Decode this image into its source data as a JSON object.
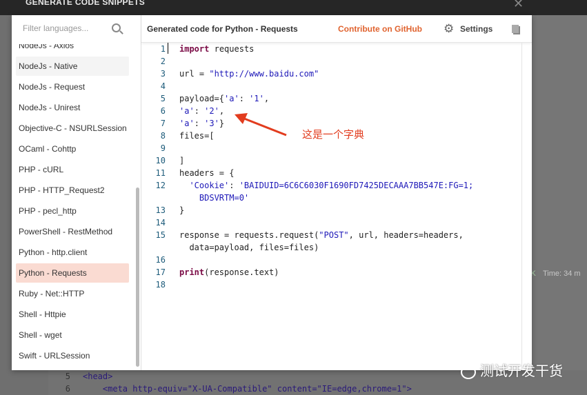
{
  "modal": {
    "title": "GENERATE CODE SNIPPETS"
  },
  "sidebar": {
    "filter_placeholder": "Filter languages...",
    "items": [
      "NodeJs - Axios",
      "NodeJs - Native",
      "NodeJs - Request",
      "NodeJs - Unirest",
      "Objective-C - NSURLSession",
      "OCaml - Cohttp",
      "PHP - cURL",
      "PHP - HTTP_Request2",
      "PHP - pecl_http",
      "PowerShell - RestMethod",
      "Python - http.client",
      "Python - Requests",
      "Ruby - Net::HTTP",
      "Shell - Httpie",
      "Shell - wget",
      "Swift - URLSession"
    ],
    "selected": "Python - Requests"
  },
  "header": {
    "title": "Generated code for Python - Requests",
    "github": "Contribute on GitHub",
    "settings": "Settings"
  },
  "code": [
    {
      "n": "1",
      "t": [
        [
          "kw",
          "import"
        ],
        [
          "",
          "requests"
        ]
      ]
    },
    {
      "n": "2",
      "t": []
    },
    {
      "n": "3",
      "t": [
        [
          "",
          "url = "
        ],
        [
          "st",
          "\"http://www.baidu.com\""
        ]
      ]
    },
    {
      "n": "4",
      "t": []
    },
    {
      "n": "5",
      "t": [
        [
          "",
          "payload={"
        ],
        [
          "st",
          "'a'"
        ],
        [
          "",
          ": "
        ],
        [
          "st",
          "'1'"
        ],
        [
          "",
          ","
        ]
      ]
    },
    {
      "n": "6",
      "t": [
        [
          "st",
          "'a'"
        ],
        [
          "",
          ": "
        ],
        [
          "st",
          "'2'"
        ],
        [
          "",
          ","
        ]
      ]
    },
    {
      "n": "7",
      "t": [
        [
          "st",
          "'a'"
        ],
        [
          "",
          ": "
        ],
        [
          "st",
          "'3'"
        ],
        [
          "",
          "}"
        ]
      ]
    },
    {
      "n": "8",
      "t": [
        [
          "",
          "files=["
        ]
      ]
    },
    {
      "n": "9",
      "t": []
    },
    {
      "n": "10",
      "t": [
        [
          "",
          "]"
        ]
      ]
    },
    {
      "n": "11",
      "t": [
        [
          "",
          "headers = {"
        ]
      ]
    },
    {
      "n": "12",
      "t": [
        [
          "",
          "  "
        ],
        [
          "st",
          "'Cookie'"
        ],
        [
          "",
          ": "
        ],
        [
          "st",
          "'BAIDUID=6C6C6030F1690FD7425DECAAA7BB547E:FG=1;"
        ]
      ]
    },
    {
      "n": "",
      "t": [
        [
          "st",
          "    BDSVRTM=0'"
        ]
      ]
    },
    {
      "n": "13",
      "t": [
        [
          "",
          "}"
        ]
      ]
    },
    {
      "n": "14",
      "t": []
    },
    {
      "n": "15",
      "t": [
        [
          "",
          "response = requests.request("
        ],
        [
          "st",
          "\"POST\""
        ],
        [
          "",
          ", url, headers=headers,"
        ]
      ]
    },
    {
      "n": "",
      "t": [
        [
          "",
          "  data=payload, files=files)"
        ]
      ]
    },
    {
      "n": "16",
      "t": []
    },
    {
      "n": "17",
      "t": [
        [
          "kw",
          "print"
        ],
        [
          "",
          "(response.text)"
        ]
      ]
    },
    {
      "n": "18",
      "t": []
    }
  ],
  "annotation": "这是一个字典",
  "background": {
    "status_ok": "K",
    "time": "Time: 34 m",
    "code": [
      {
        "n": "5",
        "t": "<head>"
      },
      {
        "n": "6",
        "t": "    <meta http-equiv=\"X-UA-Compatible\" content=\"IE=edge,chrome=1\">"
      }
    ]
  },
  "watermark": "测试开发干货",
  "colors": {
    "accent": "#e0632f",
    "selected": "#fadbd2",
    "annotation": "#e23c1e"
  }
}
